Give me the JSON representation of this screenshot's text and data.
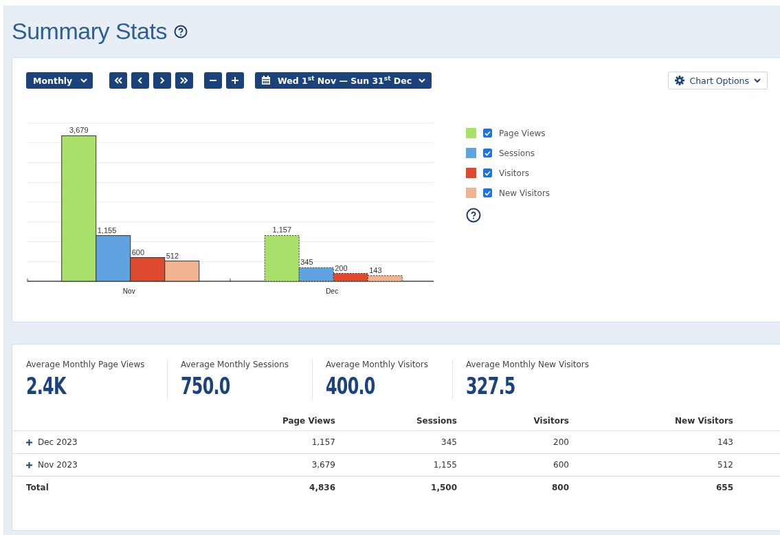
{
  "title": "Summary Stats",
  "toolbar": {
    "period": "Monthly",
    "date_range": "Wed 1$^{st}$ Nov — Sun 31$^{st}$ Dec",
    "chart_options": "Chart Options"
  },
  "chart": {
    "chart_data": {
      "type": "bar",
      "categories": [
        "Nov",
        "Dec"
      ],
      "series": [
        {
          "name": "Page Views",
          "color": "#a8e06a",
          "values": [
            3679,
            1157
          ],
          "value_labels": [
            "3,679",
            "1,157"
          ]
        },
        {
          "name": "Sessions",
          "color": "#5fa4e0",
          "values": [
            1155,
            345
          ],
          "value_labels": [
            "1,155",
            "345"
          ]
        },
        {
          "name": "Visitors",
          "color": "#dd4a2e",
          "values": [
            600,
            200
          ],
          "value_labels": [
            "600",
            "200"
          ]
        },
        {
          "name": "New Visitors",
          "color": "#efb38f",
          "values": [
            512,
            143
          ],
          "value_labels": [
            "512",
            "143"
          ]
        }
      ],
      "data_labels": true
    },
    "partial": [
      false,
      true
    ],
    "legend": [
      {
        "checked": true
      },
      {
        "checked": true
      },
      {
        "checked": true
      },
      {
        "checked": true
      }
    ]
  },
  "stats": [
    {
      "label": "Average Monthly Page Views",
      "value": "2.4K"
    },
    {
      "label": "Average Monthly Sessions",
      "value": "750.0"
    },
    {
      "label": "Average Monthly Visitors",
      "value": "400.0"
    },
    {
      "label": "Average Monthly New Visitors",
      "value": "327.5"
    }
  ],
  "table": {
    "columns": [
      "Page Views",
      "Sessions",
      "Visitors",
      "New Visitors"
    ],
    "rows": [
      {
        "label": "Dec 2023",
        "expanded": false,
        "cells": [
          "1,157",
          "345",
          "200",
          "143"
        ]
      },
      {
        "label": "Nov 2023",
        "expanded": false,
        "cells": [
          "3,679",
          "1,155",
          "600",
          "512"
        ]
      }
    ],
    "total": {
      "label": "Total",
      "cells": [
        "4,836",
        "1,500",
        "800",
        "655"
      ]
    }
  }
}
